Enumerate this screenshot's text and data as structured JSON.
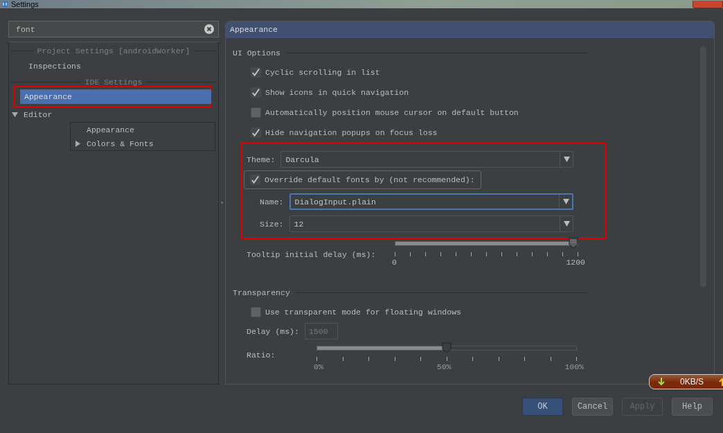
{
  "window": {
    "title": "Settings"
  },
  "search": {
    "value": "font"
  },
  "tree": [
    {
      "kind": "header",
      "label": "Project Settings [androidWorker]"
    },
    {
      "kind": "item",
      "label": "Inspections",
      "selected": false,
      "highlighted": false
    },
    {
      "kind": "header",
      "label": "IDE Settings"
    },
    {
      "kind": "item",
      "label": "Appearance",
      "selected": true,
      "highlighted": true
    },
    {
      "kind": "group",
      "label": "Editor",
      "expanded": true,
      "children": [
        {
          "kind": "leaf",
          "label": "Appearance"
        },
        {
          "kind": "folder",
          "label": "Colors & Fonts",
          "expanded": false
        }
      ]
    }
  ],
  "panel": {
    "title": "Appearance"
  },
  "ui_options": {
    "title": "UI Options",
    "checkboxes": [
      {
        "label": "Cyclic scrolling in list",
        "checked": true
      },
      {
        "label": "Show icons in quick navigation",
        "checked": true
      },
      {
        "label": "Automatically position mouse cursor on default button",
        "checked": false
      },
      {
        "label": "Hide navigation popups on focus loss",
        "checked": true
      }
    ],
    "highlighted": true,
    "theme": {
      "label": "Theme:",
      "value": "Darcula"
    },
    "override": {
      "label": "Override default fonts by (not recommended):",
      "checked": true
    },
    "font_name": {
      "label": "Name:",
      "value": "DialogInput.plain",
      "focused": true
    },
    "font_size": {
      "label": "Size:",
      "value": "12",
      "focused": false
    },
    "tooltip_delay": {
      "label": "Tooltip initial delay (ms):",
      "level": 1,
      "tick_labels": [
        "0",
        "1200"
      ]
    }
  },
  "transparency": {
    "title": "Transparency",
    "checkbox": {
      "label": "Use transparent mode for floating windows",
      "checked": false
    },
    "delay": {
      "label": "Delay (ms):",
      "value": "1500",
      "disabled": true
    },
    "ratio": {
      "label": "Ratio:",
      "level": 0.5,
      "tick_labels": [
        "0%",
        "50%",
        "100%"
      ]
    }
  },
  "network_widget": {
    "speed": "0KB/S"
  },
  "buttons": [
    {
      "label": "OK",
      "kind": "default"
    },
    {
      "label": "Cancel",
      "kind": "normal"
    },
    {
      "label": "Apply",
      "kind": "disabled"
    },
    {
      "label": "Help",
      "kind": "normal"
    }
  ]
}
